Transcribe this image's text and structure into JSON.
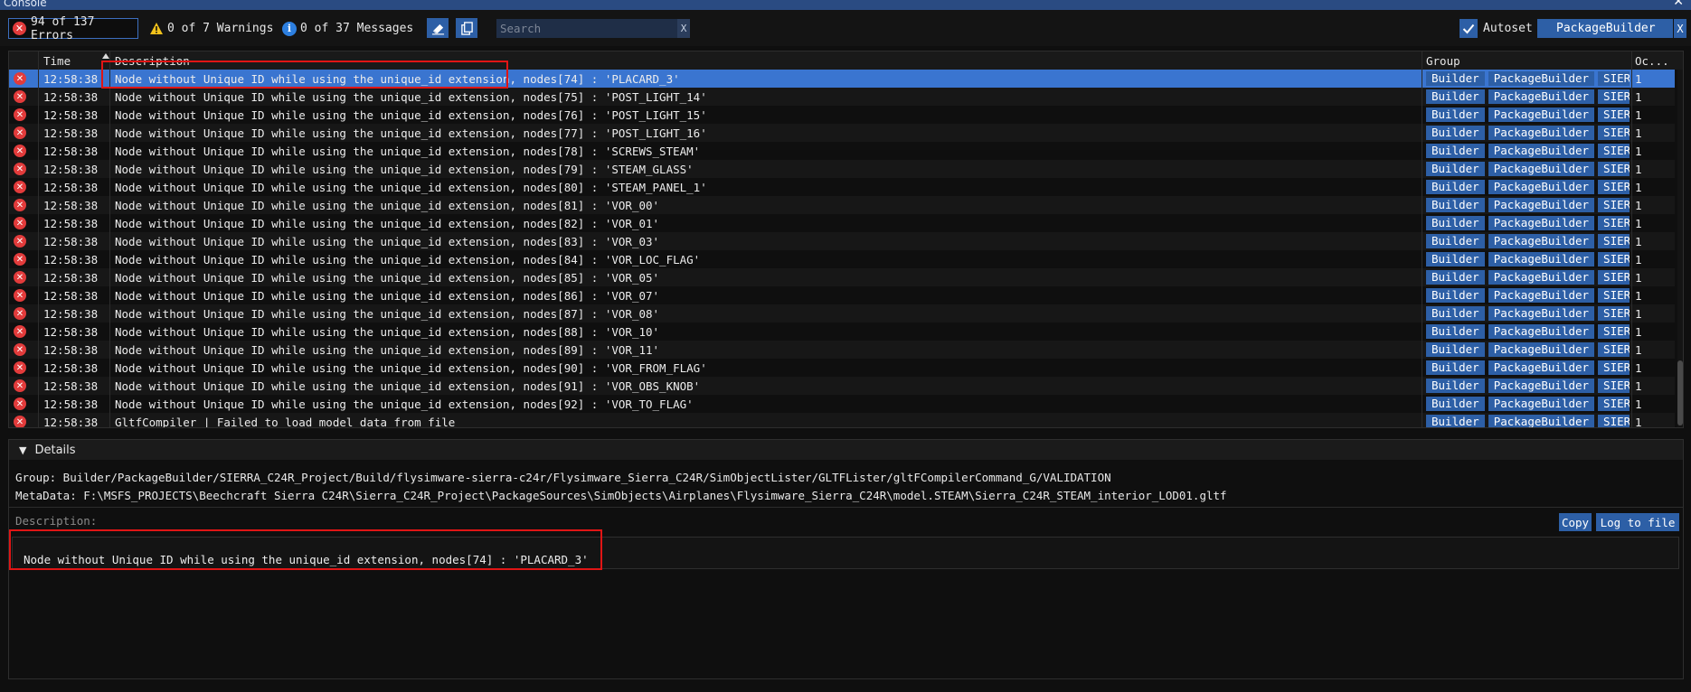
{
  "window": {
    "title": "Console",
    "close_label": "✕"
  },
  "toolbar": {
    "errors": "94 of 137 Errors",
    "warnings": "0 of 7 Warnings",
    "messages": "0 of 37 Messages",
    "search_placeholder": "Search",
    "search_clear": "X",
    "autoset_label": "Autoset",
    "group_filter": "PackageBuilder",
    "group_filter_clear": "X"
  },
  "table": {
    "headers": {
      "time": "Time",
      "description": "Description",
      "group": "Group",
      "occurrences": "Oc..."
    },
    "rows": [
      {
        "time": "12:58:38",
        "description": "Node without Unique ID while using the unique_id extension, nodes[74] : 'PLACARD_3'",
        "groups": [
          "Builder",
          "PackageBuilder",
          "SIERR"
        ],
        "count": "1",
        "selected": true
      },
      {
        "time": "12:58:38",
        "description": "Node without Unique ID while using the unique_id extension, nodes[75] : 'POST_LIGHT_14'",
        "groups": [
          "Builder",
          "PackageBuilder",
          "SIERR"
        ],
        "count": "1"
      },
      {
        "time": "12:58:38",
        "description": "Node without Unique ID while using the unique_id extension, nodes[76] : 'POST_LIGHT_15'",
        "groups": [
          "Builder",
          "PackageBuilder",
          "SIERR"
        ],
        "count": "1"
      },
      {
        "time": "12:58:38",
        "description": "Node without Unique ID while using the unique_id extension, nodes[77] : 'POST_LIGHT_16'",
        "groups": [
          "Builder",
          "PackageBuilder",
          "SIERR"
        ],
        "count": "1"
      },
      {
        "time": "12:58:38",
        "description": "Node without Unique ID while using the unique_id extension, nodes[78] : 'SCREWS_STEAM'",
        "groups": [
          "Builder",
          "PackageBuilder",
          "SIERR"
        ],
        "count": "1"
      },
      {
        "time": "12:58:38",
        "description": "Node without Unique ID while using the unique_id extension, nodes[79] : 'STEAM_GLASS'",
        "groups": [
          "Builder",
          "PackageBuilder",
          "SIERR"
        ],
        "count": "1"
      },
      {
        "time": "12:58:38",
        "description": "Node without Unique ID while using the unique_id extension, nodes[80] : 'STEAM_PANEL_1'",
        "groups": [
          "Builder",
          "PackageBuilder",
          "SIERR"
        ],
        "count": "1"
      },
      {
        "time": "12:58:38",
        "description": "Node without Unique ID while using the unique_id extension, nodes[81] : 'VOR_00'",
        "groups": [
          "Builder",
          "PackageBuilder",
          "SIERR"
        ],
        "count": "1"
      },
      {
        "time": "12:58:38",
        "description": "Node without Unique ID while using the unique_id extension, nodes[82] : 'VOR_01'",
        "groups": [
          "Builder",
          "PackageBuilder",
          "SIERR"
        ],
        "count": "1"
      },
      {
        "time": "12:58:38",
        "description": "Node without Unique ID while using the unique_id extension, nodes[83] : 'VOR_03'",
        "groups": [
          "Builder",
          "PackageBuilder",
          "SIERR"
        ],
        "count": "1"
      },
      {
        "time": "12:58:38",
        "description": "Node without Unique ID while using the unique_id extension, nodes[84] : 'VOR_LOC_FLAG'",
        "groups": [
          "Builder",
          "PackageBuilder",
          "SIERR"
        ],
        "count": "1"
      },
      {
        "time": "12:58:38",
        "description": "Node without Unique ID while using the unique_id extension, nodes[85] : 'VOR_05'",
        "groups": [
          "Builder",
          "PackageBuilder",
          "SIERR"
        ],
        "count": "1"
      },
      {
        "time": "12:58:38",
        "description": "Node without Unique ID while using the unique_id extension, nodes[86] : 'VOR_07'",
        "groups": [
          "Builder",
          "PackageBuilder",
          "SIERR"
        ],
        "count": "1"
      },
      {
        "time": "12:58:38",
        "description": "Node without Unique ID while using the unique_id extension, nodes[87] : 'VOR_08'",
        "groups": [
          "Builder",
          "PackageBuilder",
          "SIERR"
        ],
        "count": "1"
      },
      {
        "time": "12:58:38",
        "description": "Node without Unique ID while using the unique_id extension, nodes[88] : 'VOR_10'",
        "groups": [
          "Builder",
          "PackageBuilder",
          "SIERR"
        ],
        "count": "1"
      },
      {
        "time": "12:58:38",
        "description": "Node without Unique ID while using the unique_id extension, nodes[89] : 'VOR_11'",
        "groups": [
          "Builder",
          "PackageBuilder",
          "SIERR"
        ],
        "count": "1"
      },
      {
        "time": "12:58:38",
        "description": "Node without Unique ID while using the unique_id extension, nodes[90] : 'VOR_FROM_FLAG'",
        "groups": [
          "Builder",
          "PackageBuilder",
          "SIERR"
        ],
        "count": "1"
      },
      {
        "time": "12:58:38",
        "description": "Node without Unique ID while using the unique_id extension, nodes[91] : 'VOR_OBS_KNOB'",
        "groups": [
          "Builder",
          "PackageBuilder",
          "SIERR"
        ],
        "count": "1"
      },
      {
        "time": "12:58:38",
        "description": "Node without Unique ID while using the unique_id extension, nodes[92] : 'VOR_TO_FLAG'",
        "groups": [
          "Builder",
          "PackageBuilder",
          "SIERR"
        ],
        "count": "1"
      },
      {
        "time": "12:58:38",
        "description": "GltfCompiler | Failed to load model data from file",
        "groups": [
          "Builder",
          "PackageBuilder",
          "SIERR"
        ],
        "count": "1"
      }
    ]
  },
  "details": {
    "header": "Details",
    "group_line": "Group: Builder/PackageBuilder/SIERRA_C24R_Project/Build/flysimware-sierra-c24r/Flysimware_Sierra_C24R/SimObjectLister/GLTFLister/gltFCompilerCommand_G/VALIDATION",
    "metadata_line": "MetaData: F:\\MSFS_PROJECTS\\Beechcraft Sierra C24R\\Sierra_C24R_Project\\PackageSources\\SimObjects\\Airplanes\\Flysimware_Sierra_C24R\\model.STEAM\\Sierra_C24R_STEAM_interior_LOD01.gltf",
    "description_label": "Description:",
    "copy_label": "Copy",
    "log_label": "Log to file",
    "description_text": "Node without Unique ID while using the unique_id extension, nodes[74] : 'PLACARD_3'"
  },
  "colors": {
    "accent": "#2d5fa6",
    "selection": "#3a75d0",
    "error": "#e23b3b",
    "warning": "#f2c21b",
    "info": "#2d7fe0",
    "annotation": "#e01515"
  }
}
